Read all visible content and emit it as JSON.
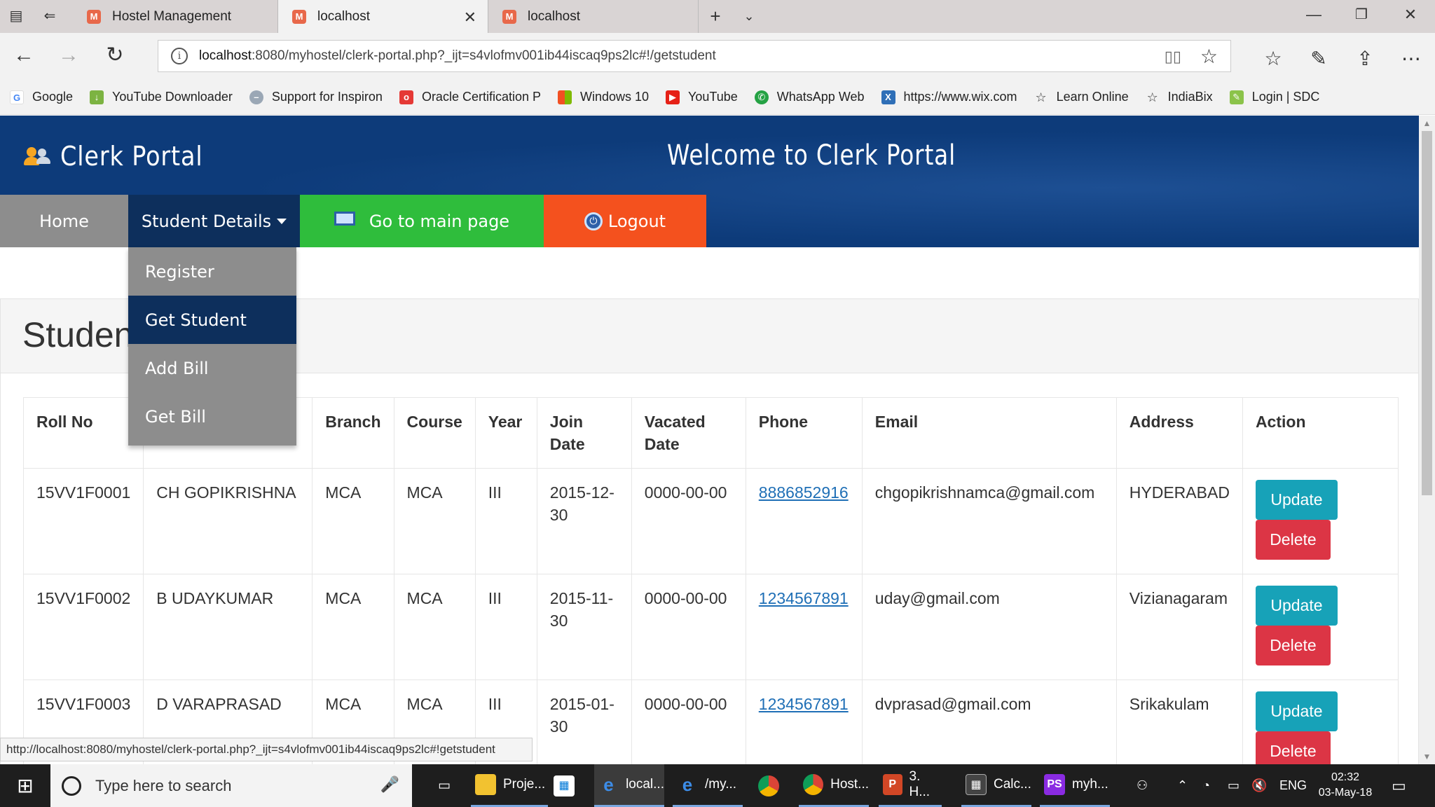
{
  "browser": {
    "tabs": [
      {
        "title": "Hostel Management",
        "active": false
      },
      {
        "title": "localhost",
        "active": true
      },
      {
        "title": "localhost",
        "active": false
      }
    ],
    "url_host": "localhost",
    "url_rest": ":8080/myhostel/clerk-portal.php?_ijt=s4vlofmv001ib44iscaq9ps2lc#!/getstudent",
    "favorites": [
      "Google",
      "YouTube Downloader",
      "Support for Inspiron",
      "Oracle Certification P",
      "Windows 10",
      "YouTube",
      "WhatsApp Web",
      "https://www.wix.com",
      "Learn Online",
      "IndiaBix",
      "Login | SDC"
    ],
    "status_url": "http://localhost:8080/myhostel/clerk-portal.php?_ijt=s4vlofmv001ib44iscaq9ps2lc#!getstudent"
  },
  "header": {
    "brand": "Clerk Portal",
    "welcome": "Welcome to Clerk Portal"
  },
  "nav": {
    "home": "Home",
    "student_details": "Student Details",
    "main_page": "Go to main page",
    "logout": "Logout"
  },
  "dropdown": {
    "items": [
      "Register",
      "Get Student",
      "Add Bill",
      "Get Bill"
    ],
    "active": "Get Student"
  },
  "panel": {
    "title": "Studen"
  },
  "table": {
    "headers": [
      "Roll No",
      "",
      "Branch",
      "Course",
      "Year",
      "Join Date",
      "Vacated Date",
      "Phone",
      "Email",
      "Address",
      "Action"
    ],
    "rows": [
      {
        "roll": "15VV1F0001",
        "name": "CH GOPIKRISHNA",
        "branch": "MCA",
        "course": "MCA",
        "year": "III",
        "join": "2015-12-30",
        "vacated": "0000-00-00",
        "phone": "8886852916",
        "email": "chgopikrishnamca@gmail.com",
        "address": "HYDERABAD"
      },
      {
        "roll": "15VV1F0002",
        "name": "B UDAYKUMAR",
        "branch": "MCA",
        "course": "MCA",
        "year": "III",
        "join": "2015-11-30",
        "vacated": "0000-00-00",
        "phone": "1234567891",
        "email": "uday@gmail.com",
        "address": "Vizianagaram"
      },
      {
        "roll": "15VV1F0003",
        "name": "D VARAPRASAD",
        "branch": "MCA",
        "course": "MCA",
        "year": "III",
        "join": "2015-01-30",
        "vacated": "0000-00-00",
        "phone": "1234567891",
        "email": "dvprasad@gmail.com",
        "address": "Srikakulam"
      }
    ],
    "update_label": "Update",
    "delete_label": "Delete"
  },
  "taskbar": {
    "search_placeholder": "Type here to search",
    "tasks": [
      "Proje...",
      "local...",
      "/my...",
      "Host...",
      "3. H...",
      "Calc...",
      "myh..."
    ],
    "lang": "ENG",
    "time": "02:32",
    "date": "03-May-18"
  },
  "colors": {
    "banner": "#0d3b7a",
    "nav_home": "#8d8d8d",
    "nav_student": "#0d2f5c",
    "nav_main": "#2fbd3c",
    "nav_logout": "#f4511e",
    "btn_update": "#17a2b8",
    "btn_delete": "#dc3545"
  }
}
